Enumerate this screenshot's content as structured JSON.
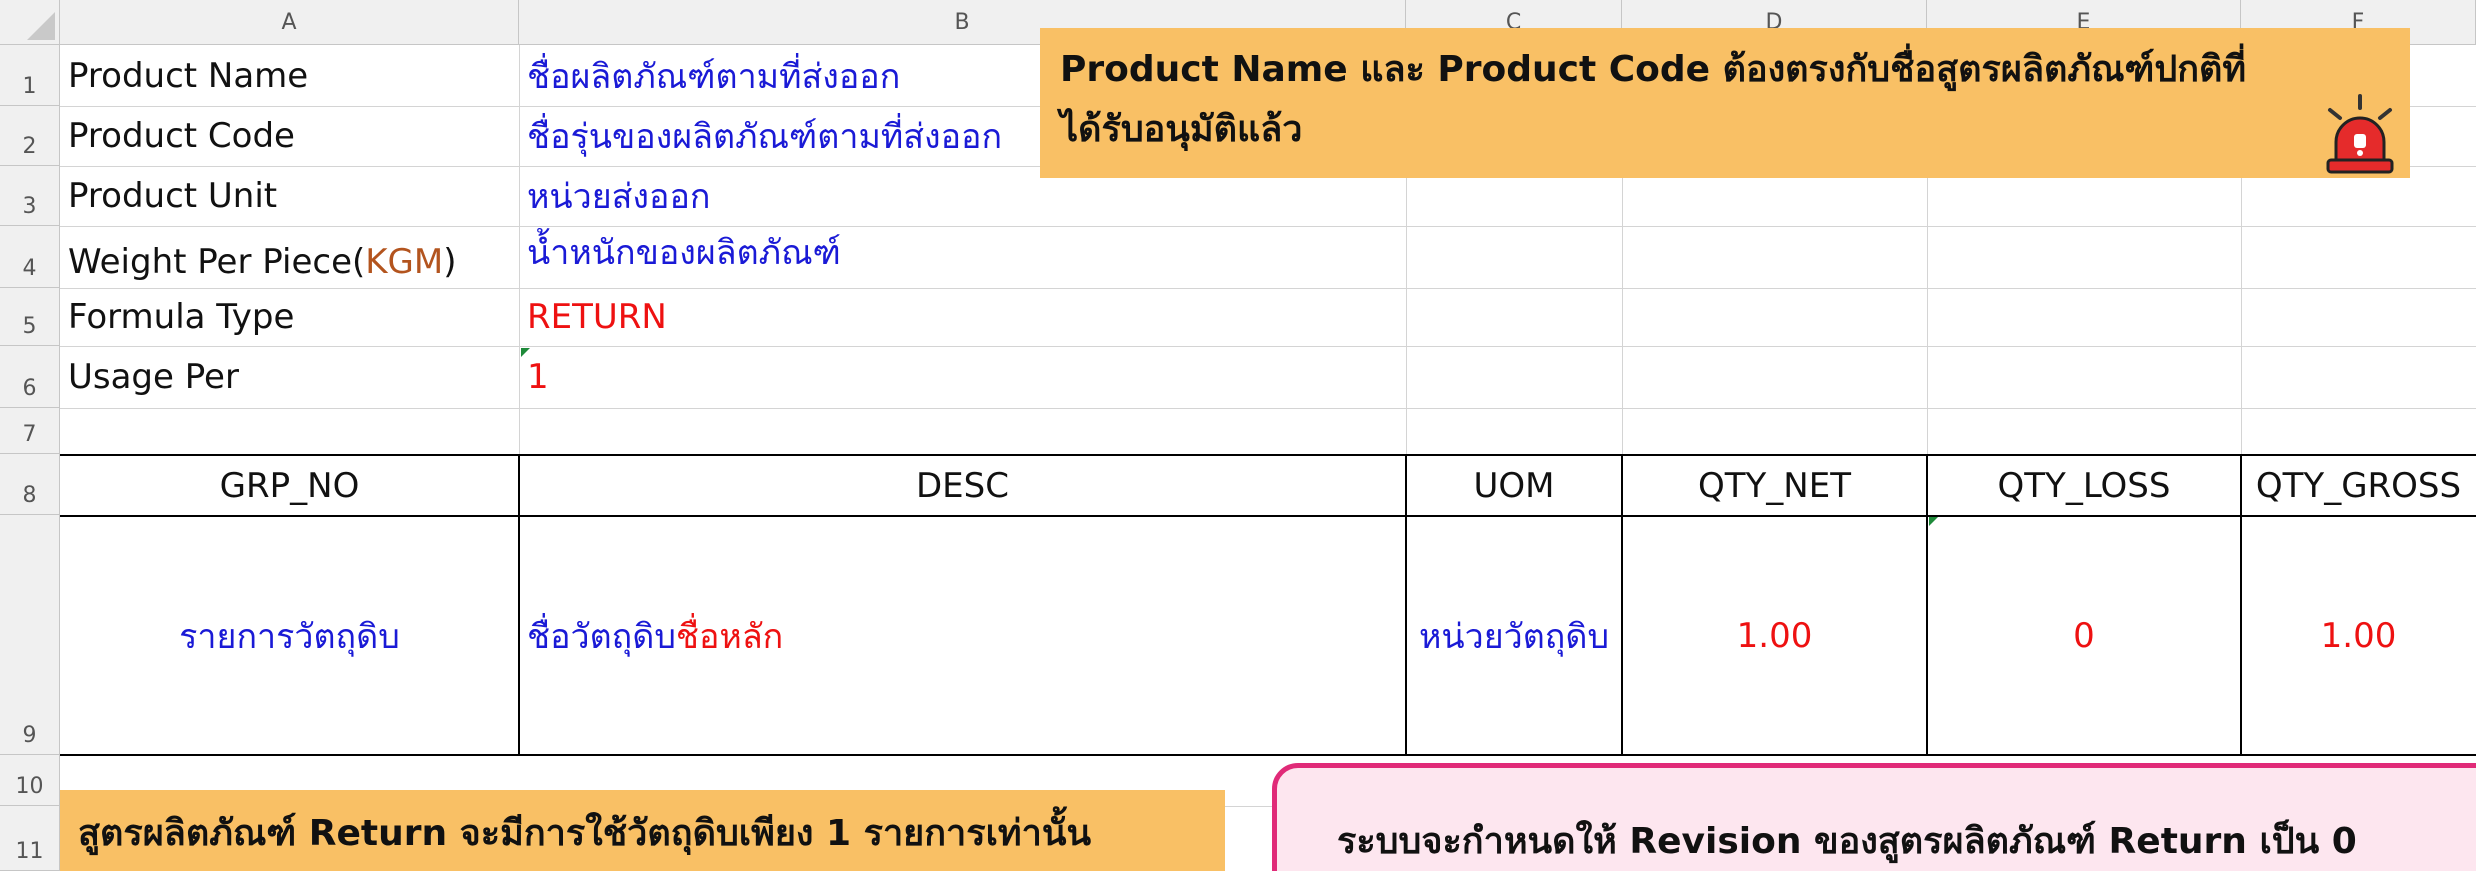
{
  "columns": [
    "A",
    "B",
    "C",
    "D",
    "E",
    "F"
  ],
  "rows": [
    "1",
    "2",
    "3",
    "4",
    "5",
    "6",
    "7",
    "8",
    "9",
    "10",
    "11"
  ],
  "params": [
    {
      "label": "Product Name",
      "value": "ชื่อผลิตภัณฑ์ตามที่ส่งออก"
    },
    {
      "label": "Product Code",
      "value": "ชื่อรุ่นของผลิตภัณฑ์ตามที่ส่งออก"
    },
    {
      "label": "Product Unit",
      "value": "หน่วยส่งออก"
    },
    {
      "label": "Weight Per Piece(",
      "label_unit": "KGM",
      "label_end": ")",
      "value": "น้ำหนักของผลิตภัณฑ์"
    },
    {
      "label": "Formula Type",
      "value": "RETURN"
    },
    {
      "label": "Usage Per",
      "value": "1"
    }
  ],
  "table": {
    "headers": [
      "GRP_NO",
      "DESC",
      "UOM",
      "QTY_NET",
      "QTY_LOSS",
      "QTY_GROSS"
    ],
    "row": {
      "grp_no": "รายการวัตถุดิบ",
      "desc_part1": "ชื่อวัตถุดิบ",
      "desc_part2": "ชื่อหลัก",
      "uom": "หน่วยวัตถุดิบ",
      "qty_net": "1.00",
      "qty_loss": "0",
      "qty_gross": "1.00"
    }
  },
  "callouts": {
    "top_right_line1": "Product Name และ Product Code ต้องตรงกับชื่อสูตรผลิตภัณฑ์ปกติที่",
    "top_right_line2": "ได้รับอนุมัติแล้ว",
    "bottom_left": "สูตรผลิตภัณฑ์ Return จะมีการใช้วัตถุดิบเพียง 1 รายการเท่านั้น",
    "bottom_right": "ระบบจะกำหนดให้ Revision ของสูตรผลิตภัณฑ์ Return เป็น 0"
  },
  "icons": {
    "alert": "siren-alarm-icon"
  },
  "colors": {
    "label_blue": "#1a1ad6",
    "value_red": "#ee1111",
    "callout_orange": "#f9c065",
    "callout_pink_border": "#e02a78",
    "callout_pink_bg": "#fde6ef"
  }
}
